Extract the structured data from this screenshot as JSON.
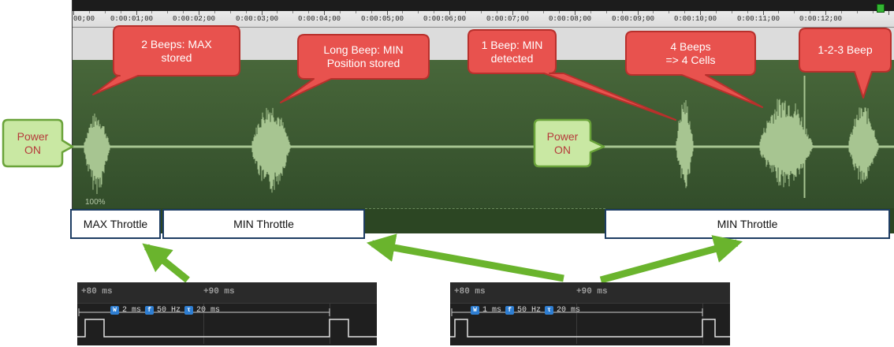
{
  "timeline": {
    "ticks": [
      "00;00",
      "0:00:01;00",
      "0:00:02;00",
      "0:00:03;00",
      "0:00:04;00",
      "0:00:05;00",
      "0:00:06;00",
      "0:00:07;00",
      "0:00:08;00",
      "0:00:09;00",
      "0:00:10;00",
      "0:00:11;00",
      "0:00:12;00"
    ],
    "zoom_label": "100%"
  },
  "callouts": {
    "max_stored": [
      "2 Beeps: MAX",
      "stored"
    ],
    "min_position": [
      "Long Beep: MIN",
      "Position stored"
    ],
    "min_detected": [
      "1 Beep: MIN",
      "detected"
    ],
    "four_cells": [
      "4 Beeps",
      "=> 4 Cells"
    ],
    "one_two_three": [
      "1-2-3 Beep"
    ]
  },
  "power_labels": {
    "left": [
      "Power",
      "ON"
    ],
    "center": [
      "Power",
      "ON"
    ]
  },
  "throttle_labels": {
    "max": "MAX Throttle",
    "min_left": "MIN Throttle",
    "min_right": "MIN Throttle"
  },
  "scopes": [
    {
      "tick1": "+80 ms",
      "tick2": "+90 ms",
      "width_label": "W",
      "width_value": "2 ms",
      "freq_label": "f",
      "freq_value": "50 Hz",
      "period_label": "τ",
      "period_value": "20 ms"
    },
    {
      "tick1": "+80 ms",
      "tick2": "+90 ms",
      "width_label": "W",
      "width_value": "1 ms",
      "freq_label": "f",
      "freq_value": "50 Hz",
      "period_label": "τ",
      "period_value": "20 ms"
    }
  ],
  "colors": {
    "callout_fill": "#e8524e",
    "callout_border": "#b8302c",
    "power_fill": "#c9e8a3",
    "power_border": "#6aa33a",
    "arrow_green": "#6ab42d",
    "wave_fill": "#a7c591",
    "throttle_border": "#1d3d63"
  }
}
